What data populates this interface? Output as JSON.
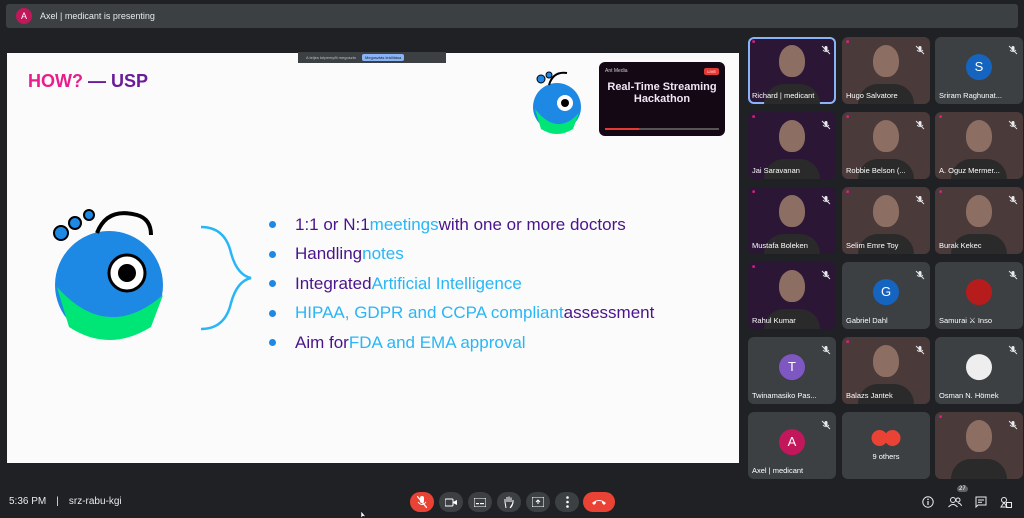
{
  "top": {
    "avatar_letter": "A",
    "presenting_text": "Axel | medicant is presenting"
  },
  "slide_toolbar": {
    "hint": "A teljes képernyőt megoszto",
    "stop": "Megosztás leállítása"
  },
  "slide": {
    "title_a": "HOW?",
    "title_b": " — USP",
    "bullets": [
      {
        "pre": "1:1 or N:1 ",
        "hl": "meetings",
        "post": " with one or more doctors"
      },
      {
        "pre": "Handling ",
        "hl": "notes",
        "post": ""
      },
      {
        "pre": "Integrated ",
        "hl": "Artificial Intelligence",
        "post": ""
      },
      {
        "pre": "",
        "hl": "HIPAA, GDPR and CCPA compliant",
        "post": " assessment"
      },
      {
        "pre": "Aim for ",
        "hl": "FDA and EMA approval",
        "post": ""
      }
    ],
    "video_card": {
      "source": "Ant Media",
      "live": "LIVE",
      "title": "Real-Time Streaming Hackathon"
    }
  },
  "participants": [
    {
      "name": "Richard | medicant",
      "type": "video"
    },
    {
      "name": "Hugo Salvatore",
      "type": "video"
    },
    {
      "name": "Sriram Raghunat...",
      "type": "avatar",
      "letter": "S",
      "color": "#1565c0"
    },
    {
      "name": "Jai Saravanan",
      "type": "video"
    },
    {
      "name": "Robbie Belson (...",
      "type": "video"
    },
    {
      "name": "A. Oguz Mermer...",
      "type": "video"
    },
    {
      "name": "Mustafa Boleken",
      "type": "video"
    },
    {
      "name": "Selim Emre Toy",
      "type": "video"
    },
    {
      "name": "Burak Kekec",
      "type": "video"
    },
    {
      "name": "Rahul Kumar",
      "type": "video"
    },
    {
      "name": "Gabriel Dahl",
      "type": "avatar",
      "letter": "G",
      "color": "#1565c0"
    },
    {
      "name": "Samurai ⚔ Inso",
      "type": "avatar",
      "letter": "",
      "color": "#b71c1c"
    },
    {
      "name": "Twinamasiko Pas...",
      "type": "avatar",
      "letter": "T",
      "color": "#7e57c2"
    },
    {
      "name": "Balazs Jantek",
      "type": "video"
    },
    {
      "name": "Osman N. Hömek",
      "type": "avatar",
      "letter": "",
      "color": "#eeeeee"
    },
    {
      "name": "Axel | medicant",
      "type": "avatar",
      "letter": "A",
      "color": "#c2185b"
    },
    {
      "name": "9 others",
      "type": "others"
    },
    {
      "name": "",
      "type": "video"
    }
  ],
  "bottom": {
    "time": "5:36 PM",
    "meeting_code": "srz-rabu-kgi",
    "participant_count": "27"
  },
  "colors": {
    "accent": "#8ab4f8",
    "danger": "#ea4335",
    "slide_title_pink": "#e91e8c",
    "slide_highlight": "#29b6f6"
  }
}
